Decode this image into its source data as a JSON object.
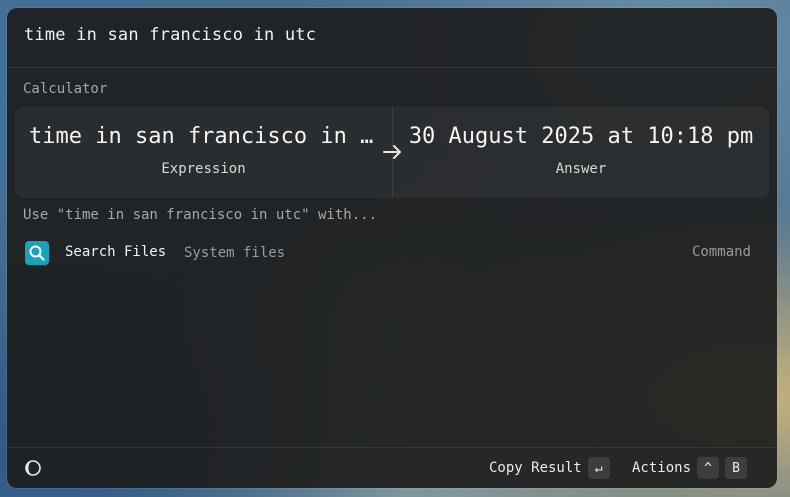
{
  "search": {
    "query": "time in san francisco in utc"
  },
  "calculator": {
    "section_title": "Calculator",
    "expression": "time in san francisco in utc",
    "expression_display": "time in san francisco in u…",
    "expression_caption": "Expression",
    "answer": "30 August 2025 at 10:18 pm",
    "answer_caption": "Answer",
    "arrow_icon": "arrow-right-icon"
  },
  "use_with": {
    "label": "Use \"time in san francisco in utc\" with..."
  },
  "results": [
    {
      "icon": "search-files-icon",
      "icon_color": "#1aa3b8",
      "title": "Search Files",
      "subtitle": "System files",
      "accessory": "Command"
    }
  ],
  "footer": {
    "left_icon": "moon-icon",
    "primary_action_label": "Copy Result",
    "primary_action_key": "↵",
    "actions_label": "Actions",
    "actions_modifier": "^",
    "actions_key": "B"
  }
}
